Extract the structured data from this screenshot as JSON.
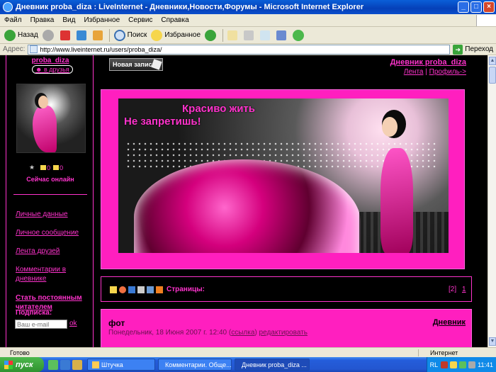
{
  "window": {
    "title": "Дневник proba_diza : LiveInternet - Дневники,Новости,Форумы - Microsoft Internet Explorer",
    "minimize": "_",
    "maximize": "□",
    "close": "×"
  },
  "menu": [
    "Файл",
    "Правка",
    "Вид",
    "Избранное",
    "Сервис",
    "Справка"
  ],
  "toolbar": {
    "back": "Назад",
    "search": "Поиск",
    "favorites": "Избранное"
  },
  "address": {
    "label": "Адрес:",
    "url": "http://www.liveinternet.ru/users/proba_diza/",
    "go": "Переход"
  },
  "sidebar": {
    "user_name": "proba_diza",
    "add_friend": "в друзья",
    "count1": "0",
    "count2": "0",
    "online": "Сейчас онлайн",
    "links": [
      "Личные данные",
      "Личное сообщение",
      "Лента друзей",
      "Комментарии в дневнике"
    ],
    "become_reader": "Стать постоянным читателем",
    "subscribe_label": "Подписка:",
    "email_placeholder": "Ваш e-mail",
    "ok": "ok"
  },
  "header": {
    "new_post": "Новая запись",
    "diary_title": "Дневник proba_diza",
    "feed": "Лента",
    "profile": "Профиль->"
  },
  "banner": {
    "slogan_line1": "Красиво жить",
    "slogan_line2": "Не запретишь!"
  },
  "pager": {
    "label": "Страницы:",
    "page_current": "[2]",
    "page_other": "1"
  },
  "post": {
    "title": "фот",
    "category": "Дневник",
    "date": "Понедельник, 18 Июня 2007 г. 12:40",
    "link_label": "ссылка",
    "edit_label": "редактировать"
  },
  "status": {
    "done": "Готово",
    "zone": "Интернет"
  },
  "taskbar": {
    "start": "пуск",
    "tasks": [
      "Штучка",
      "Комментарии. Обще...",
      "Дневник proba_diza ..."
    ],
    "lang": "RL",
    "clock": "11:41"
  }
}
